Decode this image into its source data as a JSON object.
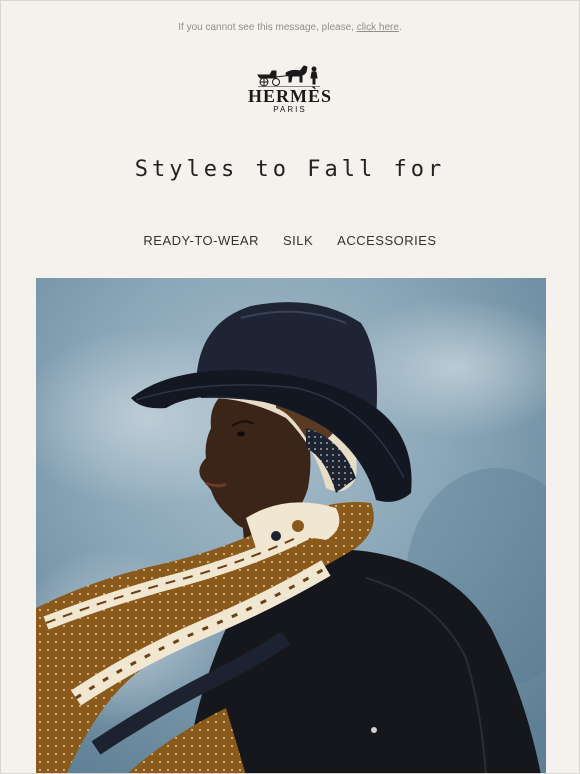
{
  "preheader": {
    "text": "If you cannot see this message, please,",
    "link_label": "click here",
    "suffix": "."
  },
  "brand": {
    "name": "HERMÈS",
    "city": "PARIS",
    "logo_icon": "horse-carriage-icon"
  },
  "headline": "Styles to Fall for",
  "nav": {
    "items": [
      {
        "label": "READY-TO-WEAR"
      },
      {
        "label": "SILK"
      },
      {
        "label": "ACCESSORIES"
      }
    ]
  },
  "hero": {
    "description_icon": "model-with-hat-and-scarf-image"
  },
  "colors": {
    "background": "#f5f2ee",
    "text": "#222222",
    "sky": "#7f9fb3"
  }
}
